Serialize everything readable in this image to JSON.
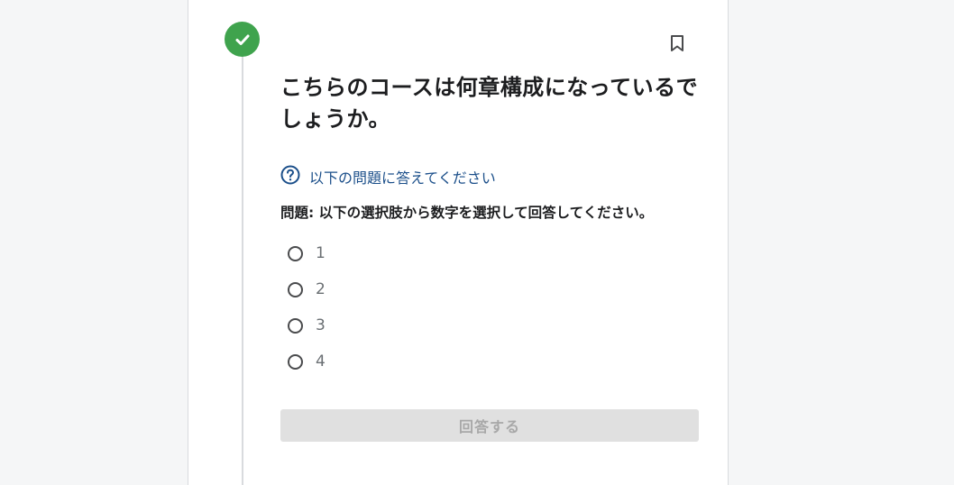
{
  "quiz": {
    "title": "こちらのコースは何章構成になっているでしょうか。",
    "hint": "以下の問題に答えてください",
    "question": "問題: 以下の選択肢から数字を選択して回答してください。",
    "options": [
      {
        "label": "1"
      },
      {
        "label": "2"
      },
      {
        "label": "3"
      },
      {
        "label": "4"
      }
    ],
    "submit_label": "回答する",
    "status": "completed"
  },
  "icons": {
    "status": "check-circle-icon",
    "bookmark": "bookmark-icon",
    "hint": "question-circle-icon"
  },
  "colors": {
    "success": "#3fa34d",
    "hint_text": "#1b4f8a",
    "disabled_button": "#e0e0e0"
  }
}
